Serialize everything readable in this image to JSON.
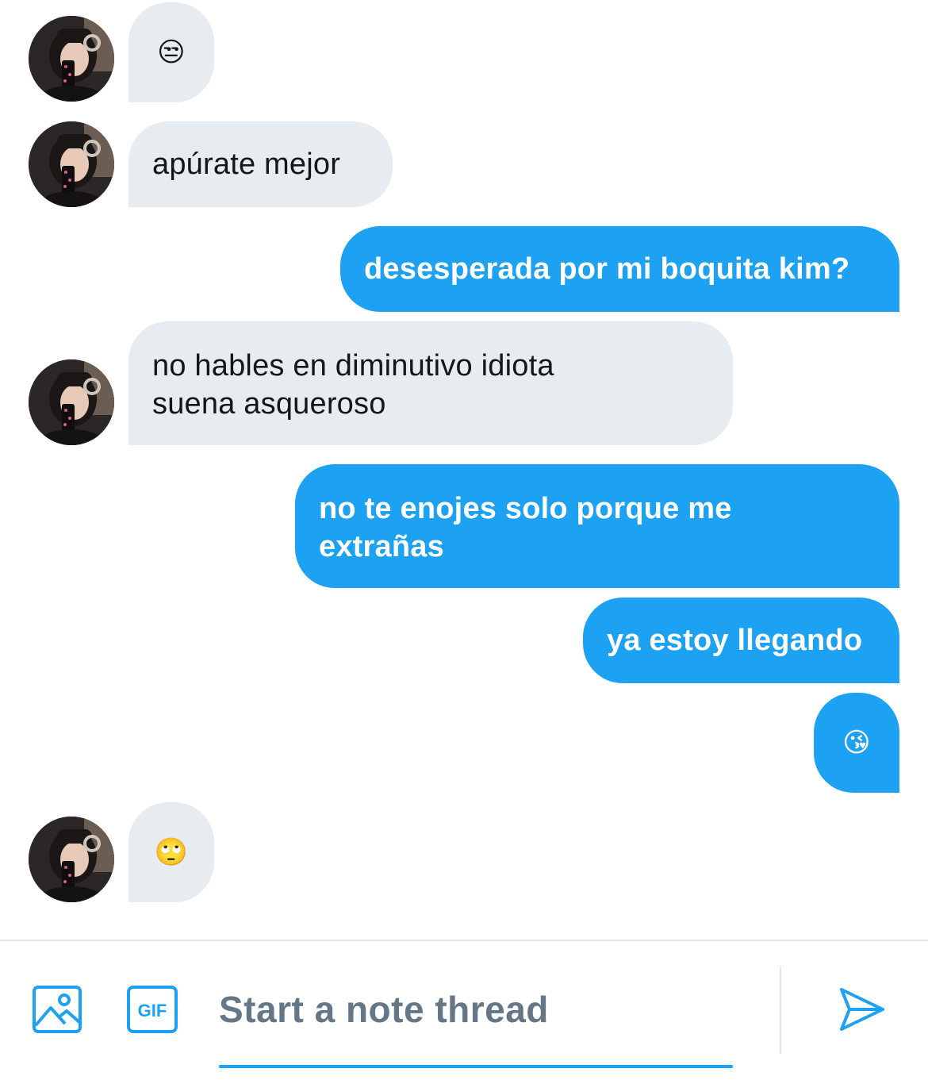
{
  "messages": [
    {
      "from": "them",
      "text": "😒"
    },
    {
      "from": "them",
      "text": "apúrate mejor"
    },
    {
      "from": "me",
      "text": "desesperada por mi boquita kim?"
    },
    {
      "from": "them",
      "line1": "no hables en diminutivo idiota",
      "line2": "suena asqueroso"
    },
    {
      "from": "me",
      "line1": "no te enojes solo porque me",
      "line2": "extrañas"
    },
    {
      "from": "me",
      "text": "ya estoy llegando"
    },
    {
      "from": "me",
      "text": "😘"
    },
    {
      "from": "them",
      "text": "🙄"
    }
  ],
  "composer": {
    "placeholder": "Start a note thread",
    "media_icon": "image-icon",
    "gif_icon": "gif-icon",
    "gif_label": "GIF",
    "send_icon": "send-icon"
  },
  "colors": {
    "accent": "#1da1f2",
    "incoming_bubble": "#e6ecf0",
    "placeholder_text": "#657786"
  }
}
